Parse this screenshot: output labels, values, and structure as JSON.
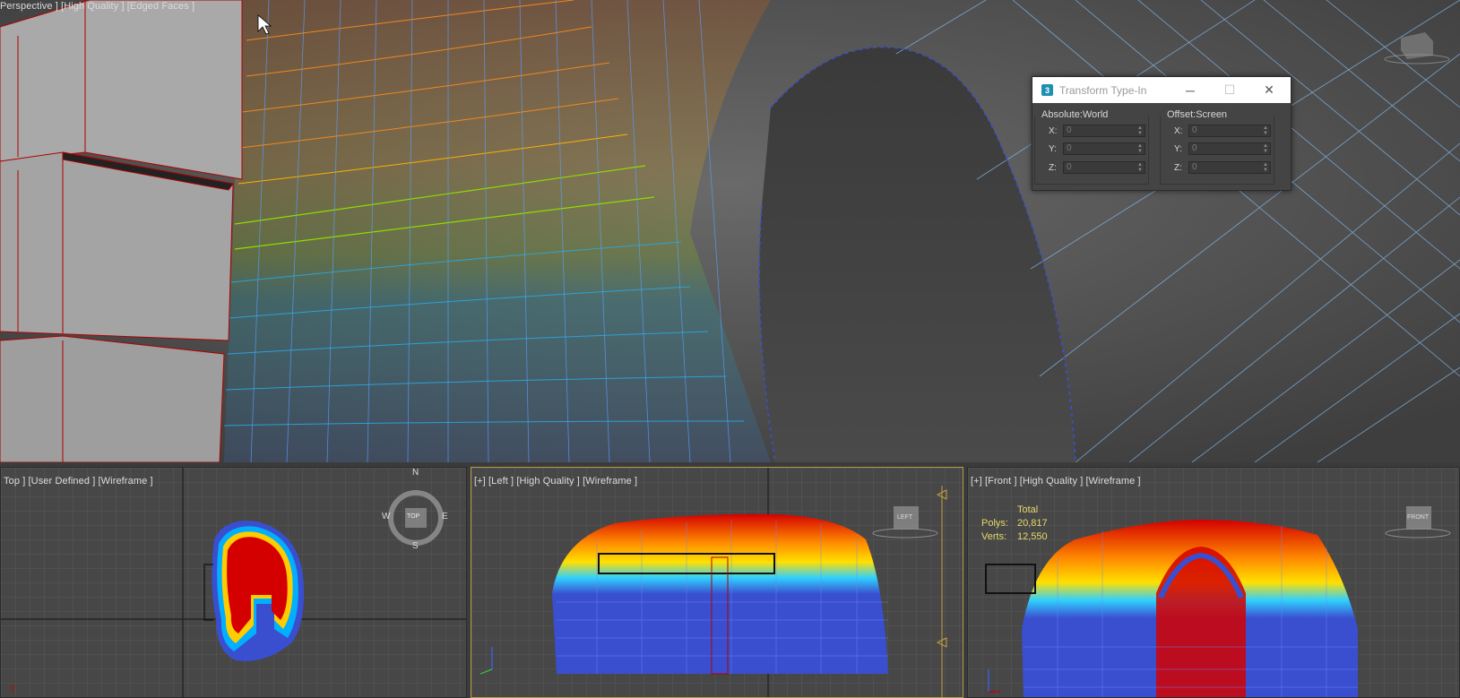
{
  "viewports": {
    "perspective": {
      "label": "Perspective ] [High Quality ] [Edged Faces ]"
    },
    "top": {
      "label": "Top ] [User Defined ] [Wireframe ]"
    },
    "left": {
      "label": "[+] [Left ] [High Quality ] [Wireframe ]",
      "cube_label": "LEFT"
    },
    "front": {
      "label": "[+] [Front ] [High Quality ] [Wireframe ]",
      "cube_label": "FRONT"
    }
  },
  "stats": {
    "header": "Total",
    "polys_label": "Polys:",
    "polys_value": "20,817",
    "verts_label": "Verts:",
    "verts_value": "12,550"
  },
  "compass": {
    "n": "N",
    "e": "E",
    "s": "S",
    "w": "W",
    "center": "TOP"
  },
  "dialog": {
    "title": "Transform Type-In",
    "app_icon": "3",
    "minimize": "─",
    "maximize": "☐",
    "close": "✕",
    "group_absolute": "Absolute:World",
    "group_offset": "Offset:Screen",
    "absolute": {
      "x_label": "X:",
      "x": "0",
      "y_label": "Y:",
      "y": "0",
      "z_label": "Z:",
      "z": "0"
    },
    "offset": {
      "x_label": "X:",
      "x": "0",
      "y_label": "Y:",
      "y": "0",
      "z_label": "Z:",
      "z": "0"
    }
  },
  "colors": {
    "active_border": "#b79a45",
    "stats_text": "#e7d96a",
    "selection_red": "#d40000",
    "wire_blue": "#3a4fd0"
  },
  "icons": {
    "spinner": "spinner-arrows-icon",
    "navcube": "viewcube-icon",
    "compass": "compass-ring-icon"
  }
}
